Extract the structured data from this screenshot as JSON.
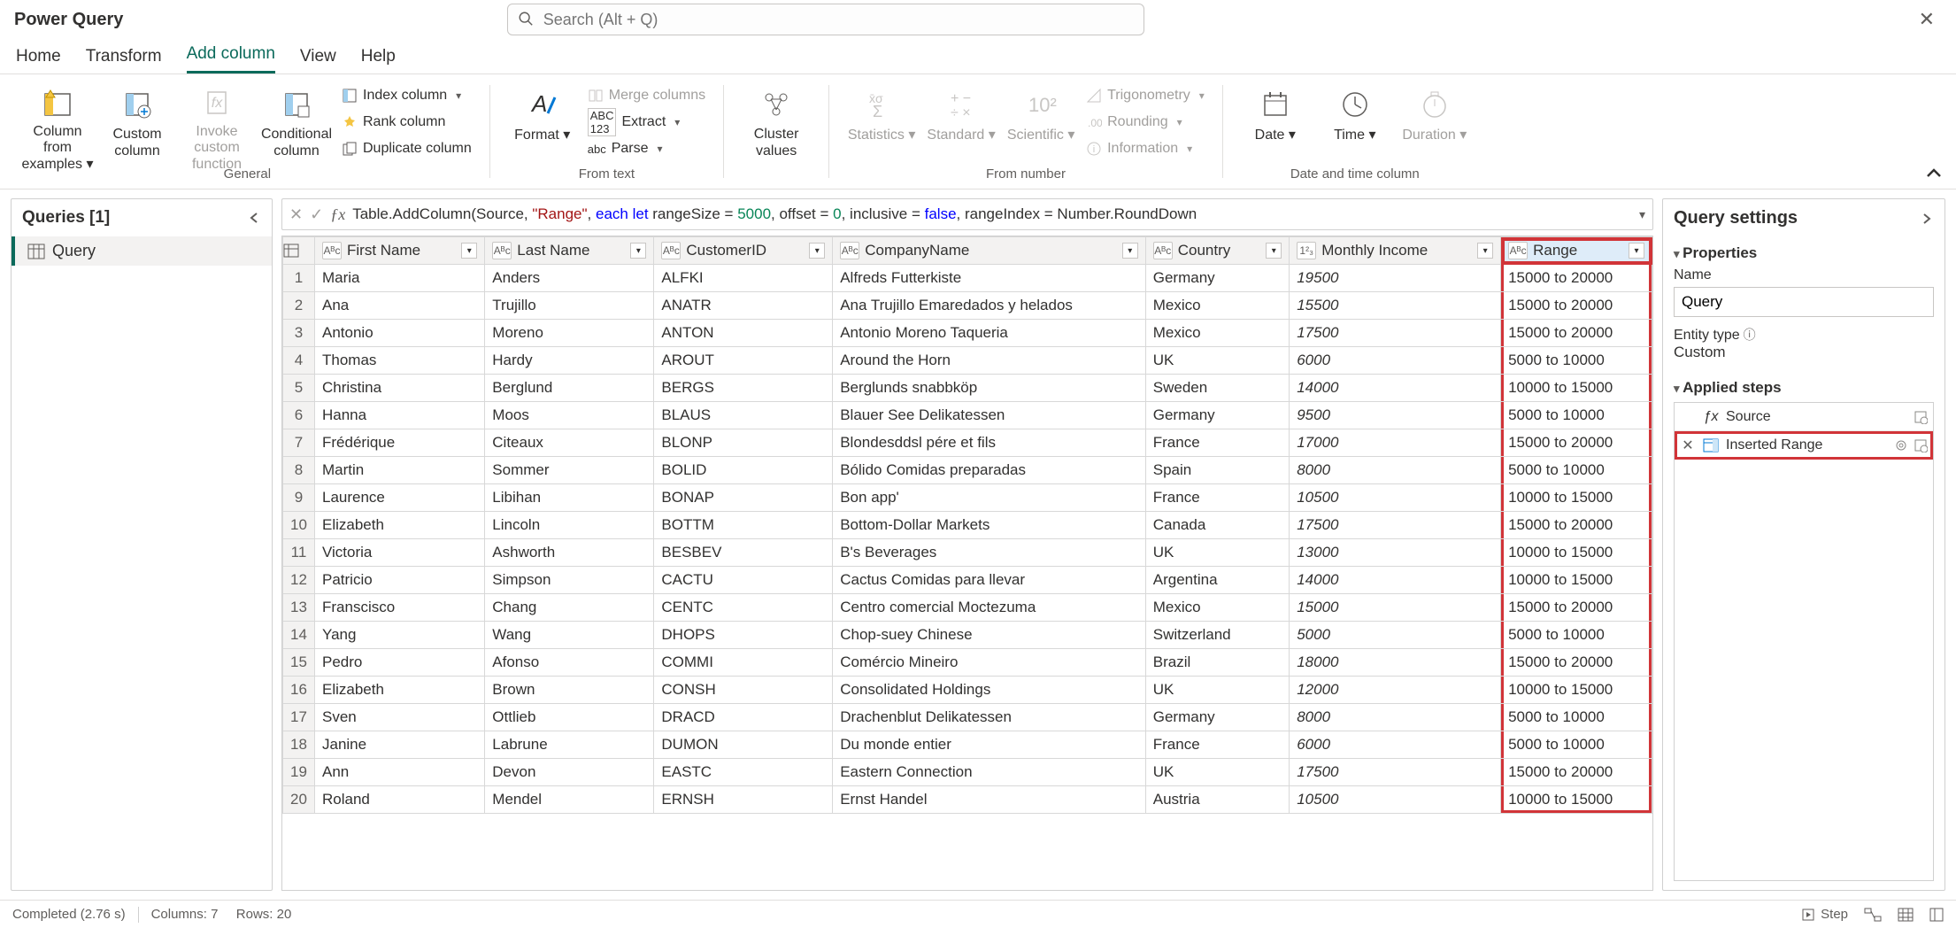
{
  "title": "Power Query",
  "search": {
    "placeholder": "Search (Alt + Q)"
  },
  "tabs": [
    "Home",
    "Transform",
    "Add column",
    "View",
    "Help"
  ],
  "active_tab": "Add column",
  "ribbon": {
    "general": {
      "label": "General",
      "column_from_examples": "Column from examples",
      "custom_column": "Custom column",
      "invoke_custom_function": "Invoke custom function",
      "conditional_column": "Conditional column",
      "index_column": "Index column",
      "rank_column": "Rank column",
      "duplicate_column": "Duplicate column"
    },
    "from_text": {
      "label": "From text",
      "format": "Format",
      "merge_columns": "Merge columns",
      "extract": "Extract",
      "parse": "Parse"
    },
    "cluster": {
      "cluster_values": "Cluster values"
    },
    "from_number": {
      "label": "From number",
      "statistics": "Statistics",
      "standard": "Standard",
      "scientific": "Scientific",
      "trigonometry": "Trigonometry",
      "rounding": "Rounding",
      "information": "Information"
    },
    "date_time": {
      "label": "Date and time column",
      "date": "Date",
      "time": "Time",
      "duration": "Duration"
    }
  },
  "queries_panel": {
    "header": "Queries [1]",
    "items": [
      "Query"
    ]
  },
  "formula_prefix": "Table.AddColumn(Source, ",
  "formula_string": "\"Range\"",
  "formula_mid1": ", ",
  "formula_kw_each": "each",
  "formula_kw_let": " let",
  "formula_mid2": " rangeSize = ",
  "formula_num1": "5000",
  "formula_mid3": ", offset = ",
  "formula_num2": "0",
  "formula_mid4": ", inclusive = ",
  "formula_kw_false": "false",
  "formula_mid5": ", rangeIndex = Number.RoundDown",
  "columns": [
    "First Name",
    "Last Name",
    "CustomerID",
    "CompanyName",
    "Country",
    "Monthly Income",
    "Range"
  ],
  "column_types": [
    "text",
    "text",
    "text",
    "text",
    "text",
    "number",
    "text"
  ],
  "rows": [
    [
      "Maria",
      "Anders",
      "ALFKI",
      "Alfreds Futterkiste",
      "Germany",
      "19500",
      "15000 to 20000"
    ],
    [
      "Ana",
      "Trujillo",
      "ANATR",
      "Ana Trujillo Emaredados y helados",
      "Mexico",
      "15500",
      "15000 to 20000"
    ],
    [
      "Antonio",
      "Moreno",
      "ANTON",
      "Antonio Moreno Taqueria",
      "Mexico",
      "17500",
      "15000 to 20000"
    ],
    [
      "Thomas",
      "Hardy",
      "AROUT",
      "Around the Horn",
      "UK",
      "6000",
      "5000 to 10000"
    ],
    [
      "Christina",
      "Berglund",
      "BERGS",
      "Berglunds snabbköp",
      "Sweden",
      "14000",
      "10000 to 15000"
    ],
    [
      "Hanna",
      "Moos",
      "BLAUS",
      "Blauer See Delikatessen",
      "Germany",
      "9500",
      "5000 to 10000"
    ],
    [
      "Frédérique",
      "Citeaux",
      "BLONP",
      "Blondesddsl pére et fils",
      "France",
      "17000",
      "15000 to 20000"
    ],
    [
      "Martin",
      "Sommer",
      "BOLID",
      "Bólido Comidas preparadas",
      "Spain",
      "8000",
      "5000 to 10000"
    ],
    [
      "Laurence",
      "Libihan",
      "BONAP",
      "Bon app'",
      "France",
      "10500",
      "10000 to 15000"
    ],
    [
      "Elizabeth",
      "Lincoln",
      "BOTTM",
      "Bottom-Dollar Markets",
      "Canada",
      "17500",
      "15000 to 20000"
    ],
    [
      "Victoria",
      "Ashworth",
      "BESBEV",
      "B's Beverages",
      "UK",
      "13000",
      "10000 to 15000"
    ],
    [
      "Patricio",
      "Simpson",
      "CACTU",
      "Cactus Comidas para llevar",
      "Argentina",
      "14000",
      "10000 to 15000"
    ],
    [
      "Franscisco",
      "Chang",
      "CENTC",
      "Centro comercial Moctezuma",
      "Mexico",
      "15000",
      "15000 to 20000"
    ],
    [
      "Yang",
      "Wang",
      "DHOPS",
      "Chop-suey Chinese",
      "Switzerland",
      "5000",
      "5000 to 10000"
    ],
    [
      "Pedro",
      "Afonso",
      "COMMI",
      "Comércio Mineiro",
      "Brazil",
      "18000",
      "15000 to 20000"
    ],
    [
      "Elizabeth",
      "Brown",
      "CONSH",
      "Consolidated Holdings",
      "UK",
      "12000",
      "10000 to 15000"
    ],
    [
      "Sven",
      "Ottlieb",
      "DRACD",
      "Drachenblut Delikatessen",
      "Germany",
      "8000",
      "5000 to 10000"
    ],
    [
      "Janine",
      "Labrune",
      "DUMON",
      "Du monde entier",
      "France",
      "6000",
      "5000 to 10000"
    ],
    [
      "Ann",
      "Devon",
      "EASTC",
      "Eastern Connection",
      "UK",
      "17500",
      "15000 to 20000"
    ],
    [
      "Roland",
      "Mendel",
      "ERNSH",
      "Ernst Handel",
      "Austria",
      "10500",
      "10000 to 15000"
    ]
  ],
  "settings": {
    "title": "Query settings",
    "properties": "Properties",
    "name_label": "Name",
    "name_value": "Query",
    "entity_type_label": "Entity type",
    "entity_type_value": "Custom",
    "applied_steps": "Applied steps",
    "steps": [
      "Source",
      "Inserted Range"
    ]
  },
  "status": {
    "completed": "Completed (2.76 s)",
    "columns": "Columns: 7",
    "rows": "Rows: 20",
    "step": "Step"
  }
}
